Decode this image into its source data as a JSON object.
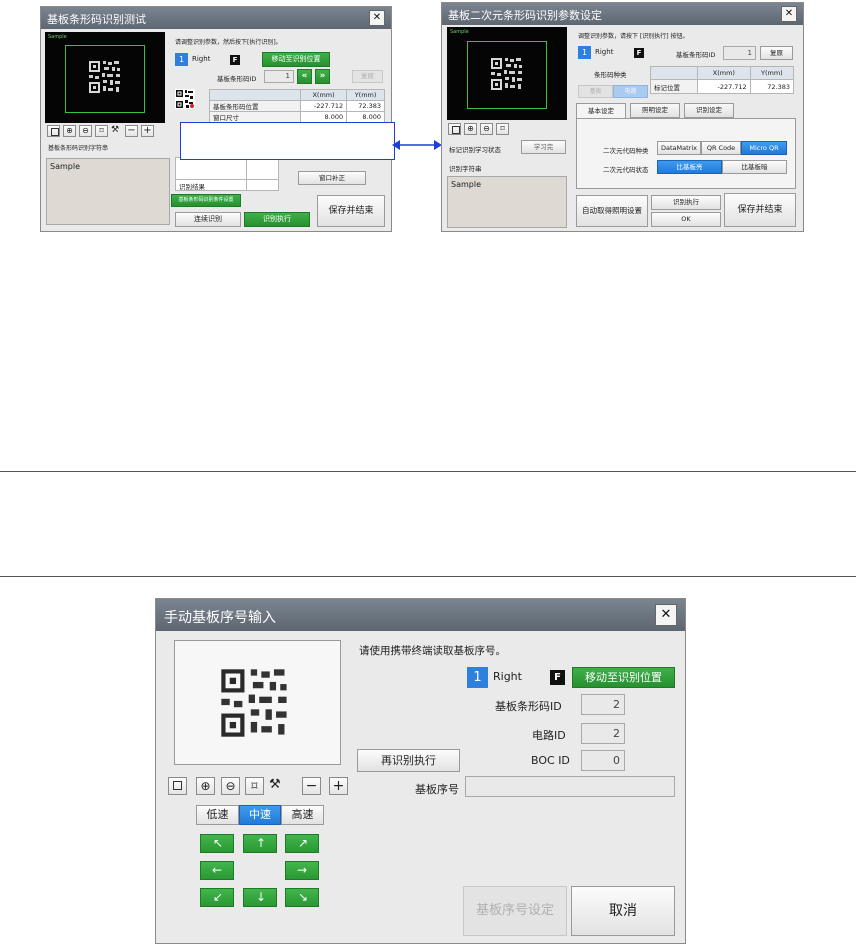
{
  "left_dialog": {
    "title": "基板条形码识别测试",
    "close": "✕",
    "camera_label": "Sample",
    "instruction": "请调整识别参数，然后按下[执行识别]。",
    "lane_number": "1",
    "lane_name": "Right",
    "f_badge": "F",
    "move_button": "移动至识别位置",
    "barcode_id_label": "基板条形码ID",
    "barcode_id_value": "1",
    "reset_button": "复原",
    "table_headers": [
      "",
      "X(mm)",
      "Y(mm)"
    ],
    "table_rows": [
      {
        "label": "基板条形码位置",
        "x": "-227.712",
        "y": "72.383"
      },
      {
        "label": "窗口尺寸",
        "x": "8.000",
        "y": "8.000"
      }
    ],
    "string_label": "基板条形码识别字符串",
    "string_value": "Sample",
    "result_label": "识别结果",
    "window_correct_button": "窗口补正",
    "condition_button": "基板条形码识别条件设置",
    "continuous_button": "连续识别",
    "execute_button": "识别执行",
    "save_exit_button": "保存并结束"
  },
  "right_dialog": {
    "title": "基板二次元条形码识别参数设定",
    "close": "✕",
    "camera_label": "Sample",
    "instruction": "调整识别参数，请按下 [识别执行] 按钮。",
    "lane_number": "1",
    "lane_name": "Right",
    "f_badge": "F",
    "barcode_id_label": "基板条形码ID",
    "barcode_id_value": "1",
    "reset_button": "复原",
    "barcode_type_label": "条形码种类",
    "type_buttons": [
      "基板",
      "电路"
    ],
    "table_headers": [
      "",
      "X(mm)",
      "Y(mm)"
    ],
    "table_row": {
      "label": "标记位置",
      "x": "-227.712",
      "y": "72.383"
    },
    "mark_state_label": "标记识别学习状态",
    "learned_button": "学习完",
    "string_label": "识别字符串",
    "string_value": "Sample",
    "tabs": [
      "基本设定",
      "照明设定",
      "识别设定"
    ],
    "code_type_label": "二次元代码种类",
    "code_types": [
      "DataMatrix",
      "QR Code",
      "Micro QR"
    ],
    "code_state_label": "二次元代码状态",
    "code_states": [
      "比基板亮",
      "比基板暗"
    ],
    "auto_light_button": "自动取得照明设置",
    "exec_button": "识别执行",
    "ok_button": "OK",
    "save_exit_button": "保存并结束"
  },
  "bottom_dialog": {
    "title": "手动基板序号输入",
    "close": "✕",
    "instruction": "请使用携带终端读取基板序号。",
    "lane_number": "1",
    "lane_name": "Right",
    "f_badge": "F",
    "move_button": "移动至识别位置",
    "barcode_id_label": "基板条形码ID",
    "barcode_id_value": "2",
    "circuit_id_label": "电路ID",
    "circuit_id_value": "2",
    "boc_id_label": "BOC ID",
    "boc_id_value": "0",
    "reexec_button": "再识别执行",
    "serial_label": "基板序号",
    "serial_value": "",
    "speed_buttons": [
      "低速",
      "中速",
      "高速"
    ],
    "set_serial_button": "基板序号设定",
    "cancel_button": "取消"
  },
  "colors": {
    "accent_blue": "#2f7fdf",
    "green": "#2a9833",
    "titlebar": "#6b7480",
    "arrow_blue": "#1d3fd6"
  }
}
